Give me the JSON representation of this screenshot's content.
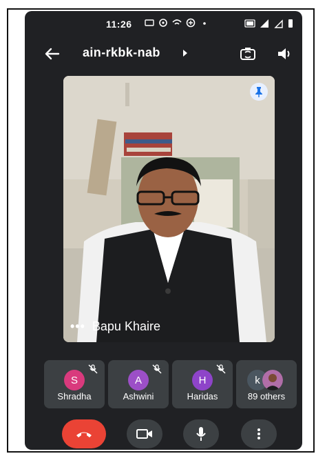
{
  "status_bar": {
    "time": "11:26"
  },
  "top_bar": {
    "meeting_code": "ain-rkbk-nab"
  },
  "main_video": {
    "speaker_name": "Bapu Khaire",
    "more_label": "•••",
    "pinned": true
  },
  "participants": [
    {
      "initial": "S",
      "name": "Shradha",
      "color": "#d93a7d",
      "muted": true
    },
    {
      "initial": "A",
      "name": "Ashwini",
      "color": "#9c4fc7",
      "muted": true
    },
    {
      "initial": "H",
      "name": "Haridas",
      "color": "#8e44c9",
      "muted": true
    }
  ],
  "others_tile": {
    "initial": "k",
    "initial_color": "#4a5660",
    "label": "89 others"
  },
  "colors": {
    "background": "#202124",
    "tile": "#3c4043",
    "hangup": "#ea4335",
    "pin_bg": "#e8f0fe"
  }
}
